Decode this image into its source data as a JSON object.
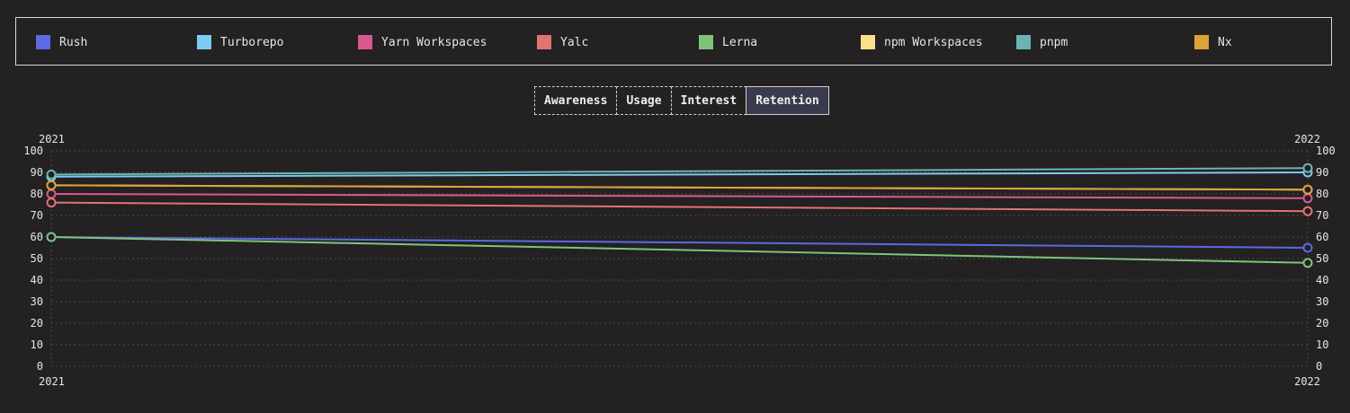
{
  "tabs": [
    "Awareness",
    "Usage",
    "Interest",
    "Retention"
  ],
  "active_tab": "Retention",
  "chart_data": {
    "type": "line",
    "x": [
      "2021",
      "2022"
    ],
    "ylim": [
      0,
      100
    ],
    "yticks": [
      0,
      10,
      20,
      30,
      40,
      50,
      60,
      70,
      80,
      90,
      100
    ],
    "grid": true,
    "legend_placement": "top",
    "series": [
      {
        "name": "Rush",
        "color": "#5a6be3",
        "values": [
          60,
          55
        ]
      },
      {
        "name": "Turborepo",
        "color": "#7dcbf0",
        "values": [
          88,
          90
        ]
      },
      {
        "name": "Yarn Workspaces",
        "color": "#d9598f",
        "values": [
          80,
          78
        ]
      },
      {
        "name": "Yalc",
        "color": "#e07471",
        "values": [
          76,
          72
        ]
      },
      {
        "name": "Lerna",
        "color": "#7fc47a",
        "values": [
          60,
          48
        ]
      },
      {
        "name": "npm Workspaces",
        "color": "#fbe089",
        "values": [
          84,
          82
        ]
      },
      {
        "name": "pnpm",
        "color": "#6bb4b2",
        "values": [
          89,
          92
        ]
      },
      {
        "name": "Nx",
        "color": "#dda237",
        "values": [
          84,
          82
        ]
      }
    ]
  }
}
